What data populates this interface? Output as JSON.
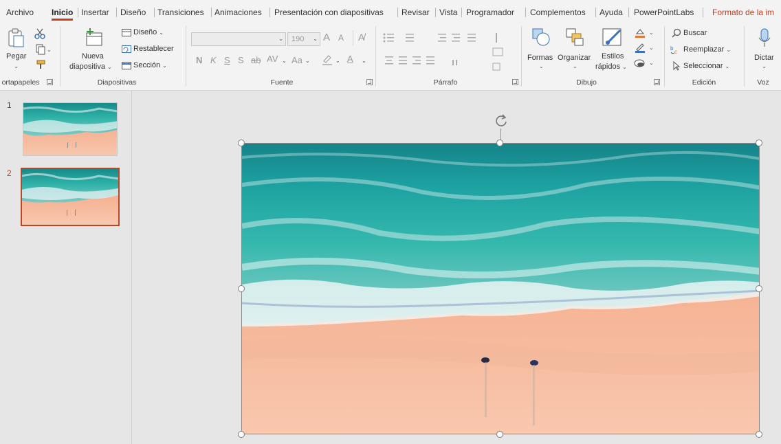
{
  "menu": {
    "tabs": [
      {
        "label": "Archivo"
      },
      {
        "label": "Inicio"
      },
      {
        "label": "Insertar"
      },
      {
        "label": "Diseño"
      },
      {
        "label": "Transiciones"
      },
      {
        "label": "Animaciones"
      },
      {
        "label": "Presentación con diapositivas"
      },
      {
        "label": "Revisar"
      },
      {
        "label": "Vista"
      },
      {
        "label": "Programador"
      },
      {
        "label": "Complementos"
      },
      {
        "label": "Ayuda"
      },
      {
        "label": "PowerPointLabs"
      },
      {
        "label": "Formato de la im"
      }
    ],
    "active_tab": "Inicio"
  },
  "ribbon": {
    "portapapeles": {
      "label": "ortapapeles",
      "paste_label": "Pegar"
    },
    "diapositivas": {
      "label": "Diapositivas",
      "new_slide_line1": "Nueva",
      "new_slide_line2": "diapositiva",
      "layout": "Diseño",
      "reset": "Restablecer",
      "section": "Sección"
    },
    "fuente": {
      "label": "Fuente",
      "font_name": "",
      "font_size": "190",
      "bold": "N",
      "italic": "K",
      "underline": "S",
      "strike": "S",
      "strikethrough": "ab",
      "spacing": "AV",
      "case": "Aa",
      "grow": "A",
      "shrink": "A",
      "font_color": "A"
    },
    "parrafo": {
      "label": "Párrafo"
    },
    "dibujo": {
      "label": "Dibujo",
      "shapes": "Formas",
      "arrange": "Organizar",
      "styles_line1": "Estilos",
      "styles_line2": "rápidos"
    },
    "edicion": {
      "label": "Edición",
      "find": "Buscar",
      "replace": "Reemplazar",
      "select": "Seleccionar"
    },
    "voz": {
      "label": "Voz",
      "dictate": "Dictar"
    }
  },
  "thumbnails": [
    {
      "number": "1",
      "active": false
    },
    {
      "number": "2",
      "active": true
    }
  ],
  "colors": {
    "accent": "#c43e1c",
    "selected_thumb_border": "#b7472a",
    "sea_deep": "#1e8f8c",
    "sea_mid": "#2fb3a8",
    "foam": "#e8f3f4",
    "sand": "#f4a98c",
    "sand_light": "#f7c3a8"
  }
}
